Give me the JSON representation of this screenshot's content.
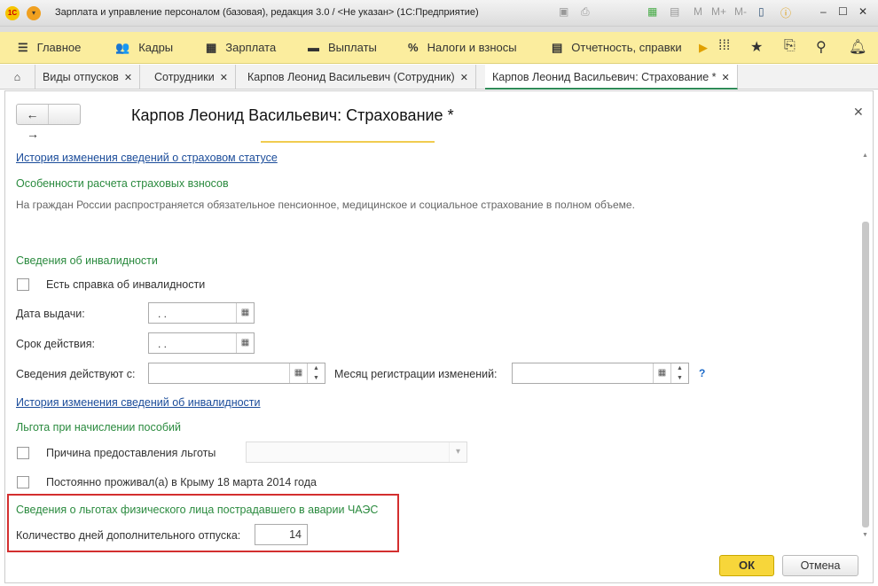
{
  "window": {
    "title": "Зарплата и управление персоналом (базовая), редакция 3.0 / <Не указан>  (1С:Предприятие)",
    "toolbar_text": [
      "M",
      "M+",
      "M-"
    ]
  },
  "menu": {
    "items": [
      {
        "icon": "☰",
        "label": "Главное"
      },
      {
        "icon": "👥",
        "label": "Кадры"
      },
      {
        "icon": "▦",
        "label": "Зарплата"
      },
      {
        "icon": "▬",
        "label": "Выплаты"
      },
      {
        "icon": "%",
        "label": "Налоги и взносы"
      },
      {
        "icon": "▤",
        "label": "Отчетность, справки"
      }
    ]
  },
  "tabs": [
    {
      "label": "Виды отпусков"
    },
    {
      "label": "Сотрудники"
    },
    {
      "label": "Карпов Леонид Васильевич (Сотрудник)"
    },
    {
      "label": "Карпов Леонид Васильевич: Страхование *",
      "active": true
    }
  ],
  "form": {
    "title": "Карпов Леонид Васильевич: Страхование *",
    "history_insurance_link": "История изменения сведений о страховом статусе",
    "contrib_header": "Особенности расчета страховых взносов",
    "contrib_text": "На граждан России распространяется обязательное пенсионное, медицинское и социальное страхование в полном объеме.",
    "disability_header": "Сведения об инвалидности",
    "has_certificate_label": "Есть справка об инвалидности",
    "issue_date_label": "Дата выдачи:",
    "issue_date_value": " .  .",
    "validity_label": "Срок действия:",
    "validity_value": " .  .",
    "effective_from_label": "Сведения действуют с:",
    "reg_month_label": "Месяц регистрации изменений:",
    "help": "?",
    "history_disability_link": "История изменения сведений об инвалидности",
    "benefit_header": "Льгота при начислении пособий",
    "benefit_reason_label": "Причина предоставления льготы",
    "crimea_label": "Постоянно проживал(а) в Крыму 18 марта 2014 года",
    "chernobyl_header": "Сведения о льготах физического лица пострадавшего в аварии ЧАЭС",
    "extra_days_label": "Количество дней дополнительного отпуска:",
    "extra_days_value": "14",
    "ok": "ОК",
    "cancel": "Отмена"
  }
}
